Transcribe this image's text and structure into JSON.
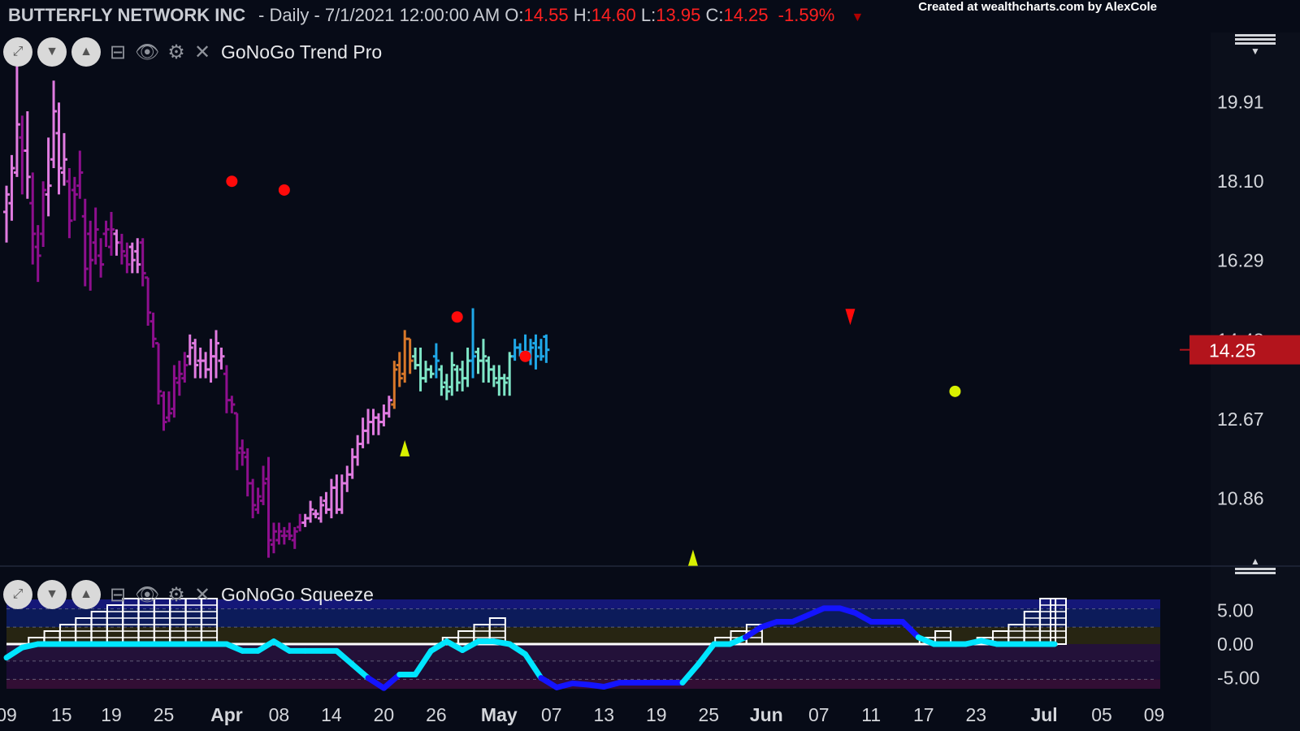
{
  "header": {
    "symbol": "BUTTERFLY NETWORK INC",
    "period": "- Daily - 7/1/2021 12:00:00 AM",
    "o_label": "O:",
    "o_value": "14.55",
    "h_label": "H:",
    "h_value": "14.60",
    "l_label": "L:",
    "l_value": "13.95",
    "c_label": "C:",
    "c_value": "14.25",
    "change": "-1.59%",
    "credit": "Created at wealthcharts.com by AlexCole"
  },
  "panels": {
    "price": {
      "title": "GoNoGo Trend Pro"
    },
    "squeeze": {
      "title": "GoNoGo Squeeze"
    }
  },
  "colors": {
    "background": "#070b17",
    "strong_nogo": "#8e0f8e",
    "weak_nogo": "#e07be0",
    "neutral": "#d9782a",
    "weak_go": "#7fe6c7",
    "strong_go": "#1fa8e8",
    "price_label_bg": "#b3141c",
    "down_red": "#ff2020",
    "marker_yellow": "#d8f000",
    "marker_red": "#ff0a0a",
    "osc_neg": "#00e5ff",
    "osc_pos": "#1414ff"
  },
  "price_label": "14.25",
  "chart_data": [
    {
      "type": "ohlc",
      "title": "GoNoGo Trend Pro",
      "y_ticks": [
        "19.91",
        "18.10",
        "16.29",
        "14.48",
        "12.67",
        "10.86"
      ],
      "ylim": [
        9.4,
        21.5
      ],
      "x_ticks": [
        "09",
        "15",
        "19",
        "25",
        "Apr",
        "08",
        "14",
        "20",
        "26",
        "May",
        "07",
        "13",
        "19",
        "25",
        "Jun",
        "07",
        "11",
        "17",
        "23",
        "Jul",
        "05",
        "09"
      ],
      "trend_key": {
        "S": "strong_nogo",
        "W": "weak_nogo",
        "N": "neutral",
        "G": "weak_go",
        "B": "strong_go"
      },
      "bars": [
        {
          "o": 17.4,
          "h": 18.0,
          "l": 16.7,
          "c": 17.8,
          "t": "W"
        },
        {
          "o": 17.6,
          "h": 18.7,
          "l": 17.2,
          "c": 18.4,
          "t": "W"
        },
        {
          "o": 18.3,
          "h": 20.8,
          "l": 18.2,
          "c": 19.4,
          "t": "W"
        },
        {
          "o": 19.1,
          "h": 19.6,
          "l": 17.8,
          "c": 18.8,
          "t": "S"
        },
        {
          "o": 18.8,
          "h": 19.7,
          "l": 17.7,
          "c": 18.2,
          "t": "W"
        },
        {
          "o": 17.6,
          "h": 18.3,
          "l": 16.2,
          "c": 16.9,
          "t": "S"
        },
        {
          "o": 16.6,
          "h": 17.1,
          "l": 15.8,
          "c": 16.4,
          "t": "S"
        },
        {
          "o": 16.9,
          "h": 18.1,
          "l": 16.6,
          "c": 17.9,
          "t": "S"
        },
        {
          "o": 17.8,
          "h": 19.1,
          "l": 17.3,
          "c": 18.0,
          "t": "W"
        },
        {
          "o": 18.6,
          "h": 20.4,
          "l": 18.4,
          "c": 19.7,
          "t": "W"
        },
        {
          "o": 19.2,
          "h": 19.9,
          "l": 17.8,
          "c": 18.4,
          "t": "W"
        },
        {
          "o": 18.3,
          "h": 19.2,
          "l": 18.0,
          "c": 18.6,
          "t": "W"
        },
        {
          "o": 18.1,
          "h": 18.4,
          "l": 16.8,
          "c": 17.2,
          "t": "S"
        },
        {
          "o": 17.9,
          "h": 18.2,
          "l": 17.2,
          "c": 17.8,
          "t": "S"
        },
        {
          "o": 18.0,
          "h": 18.8,
          "l": 17.7,
          "c": 18.3,
          "t": "S"
        },
        {
          "o": 17.3,
          "h": 17.7,
          "l": 15.7,
          "c": 16.1,
          "t": "S"
        },
        {
          "o": 16.9,
          "h": 17.2,
          "l": 15.6,
          "c": 16.3,
          "t": "S"
        },
        {
          "o": 16.7,
          "h": 17.5,
          "l": 16.2,
          "c": 17.0,
          "t": "S"
        },
        {
          "o": 16.4,
          "h": 16.8,
          "l": 15.9,
          "c": 16.2,
          "t": "S"
        },
        {
          "o": 16.9,
          "h": 17.2,
          "l": 16.6,
          "c": 17.0,
          "t": "S"
        },
        {
          "o": 16.6,
          "h": 17.4,
          "l": 16.4,
          "c": 17.0,
          "t": "S"
        },
        {
          "o": 16.9,
          "h": 17.0,
          "l": 16.4,
          "c": 16.7,
          "t": "W"
        },
        {
          "o": 16.7,
          "h": 16.9,
          "l": 16.2,
          "c": 16.5,
          "t": "S"
        },
        {
          "o": 16.4,
          "h": 16.7,
          "l": 16.0,
          "c": 16.2,
          "t": "S"
        },
        {
          "o": 16.6,
          "h": 16.7,
          "l": 16.0,
          "c": 16.3,
          "t": "W"
        },
        {
          "o": 16.5,
          "h": 16.8,
          "l": 16.0,
          "c": 16.2,
          "t": "W"
        },
        {
          "o": 16.7,
          "h": 16.8,
          "l": 15.7,
          "c": 16.0,
          "t": "S"
        },
        {
          "o": 15.9,
          "h": 15.9,
          "l": 14.8,
          "c": 15.1,
          "t": "S"
        },
        {
          "o": 14.9,
          "h": 15.1,
          "l": 14.3,
          "c": 14.5,
          "t": "S"
        },
        {
          "o": 14.4,
          "h": 14.4,
          "l": 13.0,
          "c": 13.3,
          "t": "S"
        },
        {
          "o": 13.2,
          "h": 13.3,
          "l": 12.4,
          "c": 12.6,
          "t": "S"
        },
        {
          "o": 12.7,
          "h": 13.3,
          "l": 12.6,
          "c": 12.8,
          "t": "S"
        },
        {
          "o": 12.9,
          "h": 13.9,
          "l": 12.7,
          "c": 13.6,
          "t": "S"
        },
        {
          "o": 13.5,
          "h": 14.0,
          "l": 13.2,
          "c": 13.7,
          "t": "S"
        },
        {
          "o": 13.6,
          "h": 14.2,
          "l": 13.5,
          "c": 13.9,
          "t": "S"
        },
        {
          "o": 14.1,
          "h": 14.6,
          "l": 13.9,
          "c": 14.3,
          "t": "W"
        },
        {
          "o": 14.4,
          "h": 14.5,
          "l": 13.6,
          "c": 13.9,
          "t": "W"
        },
        {
          "o": 14.0,
          "h": 14.3,
          "l": 13.6,
          "c": 14.0,
          "t": "W"
        },
        {
          "o": 14.0,
          "h": 14.2,
          "l": 13.6,
          "c": 13.8,
          "t": "W"
        },
        {
          "o": 13.8,
          "h": 14.5,
          "l": 13.5,
          "c": 14.1,
          "t": "W"
        },
        {
          "o": 14.1,
          "h": 14.7,
          "l": 13.6,
          "c": 14.4,
          "t": "W"
        },
        {
          "o": 14.0,
          "h": 14.3,
          "l": 13.8,
          "c": 14.1,
          "t": "W"
        },
        {
          "o": 13.7,
          "h": 13.9,
          "l": 12.8,
          "c": 13.1,
          "t": "S"
        },
        {
          "o": 13.1,
          "h": 13.2,
          "l": 12.8,
          "c": 13.0,
          "t": "S"
        },
        {
          "o": 12.8,
          "h": 12.8,
          "l": 11.5,
          "c": 11.9,
          "t": "S"
        },
        {
          "o": 12.0,
          "h": 12.2,
          "l": 11.6,
          "c": 11.9,
          "t": "S"
        },
        {
          "o": 11.8,
          "h": 12.0,
          "l": 10.9,
          "c": 11.2,
          "t": "S"
        },
        {
          "o": 11.2,
          "h": 11.3,
          "l": 10.4,
          "c": 10.7,
          "t": "S"
        },
        {
          "o": 10.6,
          "h": 11.1,
          "l": 10.5,
          "c": 10.9,
          "t": "S"
        },
        {
          "o": 10.8,
          "h": 11.6,
          "l": 10.7,
          "c": 11.2,
          "t": "S"
        },
        {
          "o": 11.3,
          "h": 11.8,
          "l": 9.5,
          "c": 9.9,
          "t": "S"
        },
        {
          "o": 9.8,
          "h": 10.3,
          "l": 9.6,
          "c": 10.1,
          "t": "S"
        },
        {
          "o": 9.9,
          "h": 10.3,
          "l": 9.8,
          "c": 10.1,
          "t": "S"
        },
        {
          "o": 10.0,
          "h": 10.2,
          "l": 9.8,
          "c": 10.0,
          "t": "S"
        },
        {
          "o": 10.1,
          "h": 10.3,
          "l": 9.9,
          "c": 10.0,
          "t": "S"
        },
        {
          "o": 9.9,
          "h": 10.2,
          "l": 9.7,
          "c": 10.1,
          "t": "S"
        },
        {
          "o": 10.2,
          "h": 10.5,
          "l": 10.1,
          "c": 10.3,
          "t": "S"
        },
        {
          "o": 10.3,
          "h": 10.5,
          "l": 10.2,
          "c": 10.4,
          "t": "W"
        },
        {
          "o": 10.4,
          "h": 10.8,
          "l": 10.3,
          "c": 10.6,
          "t": "W"
        },
        {
          "o": 10.5,
          "h": 10.6,
          "l": 10.4,
          "c": 10.5,
          "t": "W"
        },
        {
          "o": 10.4,
          "h": 10.9,
          "l": 10.3,
          "c": 10.7,
          "t": "W"
        },
        {
          "o": 10.8,
          "h": 11.0,
          "l": 10.5,
          "c": 10.6,
          "t": "W"
        },
        {
          "o": 10.6,
          "h": 11.3,
          "l": 10.4,
          "c": 11.1,
          "t": "W"
        },
        {
          "o": 11.1,
          "h": 11.4,
          "l": 10.5,
          "c": 10.6,
          "t": "W"
        },
        {
          "o": 10.6,
          "h": 11.4,
          "l": 10.5,
          "c": 11.2,
          "t": "W"
        },
        {
          "o": 11.2,
          "h": 11.6,
          "l": 11.0,
          "c": 11.4,
          "t": "W"
        },
        {
          "o": 11.4,
          "h": 12.0,
          "l": 11.3,
          "c": 11.8,
          "t": "W"
        },
        {
          "o": 11.8,
          "h": 12.3,
          "l": 11.6,
          "c": 12.1,
          "t": "W"
        },
        {
          "o": 12.1,
          "h": 12.7,
          "l": 12.0,
          "c": 12.4,
          "t": "W"
        },
        {
          "o": 12.4,
          "h": 12.9,
          "l": 12.1,
          "c": 12.6,
          "t": "W"
        },
        {
          "o": 12.6,
          "h": 12.9,
          "l": 12.3,
          "c": 12.7,
          "t": "W"
        },
        {
          "o": 12.7,
          "h": 12.8,
          "l": 12.3,
          "c": 12.6,
          "t": "W"
        },
        {
          "o": 12.6,
          "h": 13.0,
          "l": 12.5,
          "c": 12.8,
          "t": "W"
        },
        {
          "o": 12.8,
          "h": 13.2,
          "l": 12.7,
          "c": 13.1,
          "t": "W"
        },
        {
          "o": 13.0,
          "h": 14.0,
          "l": 12.9,
          "c": 13.8,
          "t": "N"
        },
        {
          "o": 13.9,
          "h": 14.2,
          "l": 13.4,
          "c": 13.6,
          "t": "N"
        },
        {
          "o": 13.7,
          "h": 14.7,
          "l": 13.5,
          "c": 14.5,
          "t": "N"
        },
        {
          "o": 14.5,
          "h": 14.5,
          "l": 13.7,
          "c": 14.0,
          "t": "N"
        },
        {
          "o": 14.1,
          "h": 14.3,
          "l": 13.8,
          "c": 13.9,
          "t": "G"
        },
        {
          "o": 13.9,
          "h": 14.3,
          "l": 13.3,
          "c": 13.6,
          "t": "G"
        },
        {
          "o": 13.6,
          "h": 14.0,
          "l": 13.5,
          "c": 13.8,
          "t": "G"
        },
        {
          "o": 13.8,
          "h": 13.9,
          "l": 13.6,
          "c": 13.7,
          "t": "G"
        },
        {
          "o": 14.1,
          "h": 14.4,
          "l": 13.6,
          "c": 14.0,
          "t": "B"
        },
        {
          "o": 13.8,
          "h": 13.9,
          "l": 13.2,
          "c": 13.4,
          "t": "G"
        },
        {
          "o": 13.5,
          "h": 13.7,
          "l": 13.1,
          "c": 13.3,
          "t": "G"
        },
        {
          "o": 13.4,
          "h": 14.2,
          "l": 13.2,
          "c": 13.9,
          "t": "G"
        },
        {
          "o": 13.8,
          "h": 13.9,
          "l": 13.3,
          "c": 13.5,
          "t": "G"
        },
        {
          "o": 13.8,
          "h": 14.0,
          "l": 13.3,
          "c": 13.6,
          "t": "G"
        },
        {
          "o": 13.6,
          "h": 14.3,
          "l": 13.4,
          "c": 14.0,
          "t": "G"
        },
        {
          "o": 14.0,
          "h": 15.2,
          "l": 13.6,
          "c": 14.1,
          "t": "B"
        },
        {
          "o": 14.2,
          "h": 14.3,
          "l": 13.7,
          "c": 14.0,
          "t": "G"
        },
        {
          "o": 14.0,
          "h": 14.5,
          "l": 13.5,
          "c": 14.1,
          "t": "G"
        },
        {
          "o": 14.0,
          "h": 14.1,
          "l": 13.5,
          "c": 13.8,
          "t": "G"
        },
        {
          "o": 13.8,
          "h": 13.9,
          "l": 13.4,
          "c": 13.6,
          "t": "G"
        },
        {
          "o": 13.5,
          "h": 13.9,
          "l": 13.2,
          "c": 13.6,
          "t": "G"
        },
        {
          "o": 13.6,
          "h": 13.7,
          "l": 13.2,
          "c": 13.5,
          "t": "G"
        },
        {
          "o": 13.6,
          "h": 14.2,
          "l": 13.2,
          "c": 14.1,
          "t": "G"
        },
        {
          "o": 14.1,
          "h": 14.5,
          "l": 14.0,
          "c": 14.3,
          "t": "B"
        },
        {
          "o": 14.3,
          "h": 14.4,
          "l": 14.1,
          "c": 14.2,
          "t": "B"
        },
        {
          "o": 14.1,
          "h": 14.6,
          "l": 14.0,
          "c": 14.2,
          "t": "B"
        },
        {
          "o": 14.2,
          "h": 14.5,
          "l": 13.9,
          "c": 14.3,
          "t": "B"
        },
        {
          "o": 14.4,
          "h": 14.6,
          "l": 13.8,
          "c": 14.1,
          "t": "B"
        },
        {
          "o": 14.3,
          "h": 14.5,
          "l": 14.0,
          "c": 14.1,
          "t": "B"
        },
        {
          "o": 14.55,
          "h": 14.6,
          "l": 13.95,
          "c": 14.25,
          "t": "B"
        }
      ],
      "markers": [
        {
          "bar": 43,
          "price": 18.1,
          "shape": "dot",
          "color": "marker_red"
        },
        {
          "bar": 53,
          "price": 17.9,
          "shape": "dot",
          "color": "marker_red"
        },
        {
          "bar": 86,
          "price": 15.0,
          "shape": "dot",
          "color": "marker_red"
        },
        {
          "bar": 99,
          "price": 14.1,
          "shape": "dot",
          "color": "marker_red"
        },
        {
          "bar": 76,
          "price": 12.0,
          "shape": "triangle-up",
          "color": "marker_yellow"
        },
        {
          "bar": 131,
          "price": 9.5,
          "shape": "triangle-up",
          "color": "marker_yellow"
        },
        {
          "bar": 161,
          "price": 15.0,
          "shape": "triangle-down",
          "color": "marker_red"
        },
        {
          "bar": 181,
          "price": 13.3,
          "shape": "dot",
          "color": "marker_yellow"
        }
      ]
    },
    {
      "type": "line",
      "title": "GoNoGo Squeeze",
      "y_ticks": [
        "5.00",
        "0.00",
        "-5.00"
      ],
      "ylim": [
        -6.6,
        6.6
      ],
      "x": [
        0,
        3,
        6,
        9,
        12,
        15,
        18,
        21,
        24,
        27,
        30,
        33,
        36,
        39,
        42,
        45,
        48,
        51,
        54,
        57,
        60,
        63,
        66,
        69,
        72,
        75,
        78,
        81,
        84,
        87,
        90,
        93,
        96,
        99,
        102,
        105,
        108,
        111,
        114,
        117,
        120,
        123,
        126,
        129,
        132,
        135,
        138,
        141,
        144,
        147,
        150,
        153,
        156,
        159,
        162,
        165,
        168,
        171,
        174,
        177,
        180,
        183,
        186,
        189,
        192,
        195,
        198,
        200
      ],
      "y": [
        -2.0,
        -0.5,
        0,
        0,
        0,
        0,
        0,
        0,
        0,
        0,
        0,
        0,
        0,
        0,
        0,
        -1,
        -1,
        0.4,
        -1,
        -1,
        -1,
        -1,
        -3,
        -5,
        -6.5,
        -4.5,
        -4.5,
        -1,
        0.4,
        -0.9,
        0.4,
        0.4,
        0,
        -1.5,
        -5,
        -6.4,
        -5.8,
        -6,
        -6.3,
        -5.7,
        -5.7,
        -5.7,
        -5.7,
        -5.7,
        -3,
        0,
        0,
        1,
        2.5,
        3.3,
        3.3,
        4.3,
        5.3,
        5.3,
        4.6,
        3.3,
        3.3,
        3.3,
        1,
        0,
        0,
        0,
        0.5,
        0,
        0,
        0,
        0,
        0
      ],
      "squeeze_blocks": [
        {
          "bar": 5,
          "height": 1
        },
        {
          "bar": 8,
          "height": 2
        },
        {
          "bar": 11,
          "height": 3
        },
        {
          "bar": 14,
          "height": 4
        },
        {
          "bar": 17,
          "height": 5
        },
        {
          "bar": 20,
          "height": 6
        },
        {
          "bar": 23,
          "height": 7
        },
        {
          "bar": 26,
          "height": 7
        },
        {
          "bar": 29,
          "height": 7
        },
        {
          "bar": 32,
          "height": 7
        },
        {
          "bar": 35,
          "height": 7
        },
        {
          "bar": 38,
          "height": 7
        },
        {
          "bar": 84,
          "height": 1
        },
        {
          "bar": 87,
          "height": 2
        },
        {
          "bar": 90,
          "height": 3
        },
        {
          "bar": 93,
          "height": 4
        },
        {
          "bar": 136,
          "height": 1
        },
        {
          "bar": 139,
          "height": 2
        },
        {
          "bar": 142,
          "height": 3
        },
        {
          "bar": 175,
          "height": 1
        },
        {
          "bar": 178,
          "height": 2
        },
        {
          "bar": 186,
          "height": 1
        },
        {
          "bar": 189,
          "height": 2
        },
        {
          "bar": 192,
          "height": 3
        },
        {
          "bar": 195,
          "height": 5
        },
        {
          "bar": 198,
          "height": 7
        },
        {
          "bar": 200,
          "height": 7
        }
      ]
    }
  ]
}
